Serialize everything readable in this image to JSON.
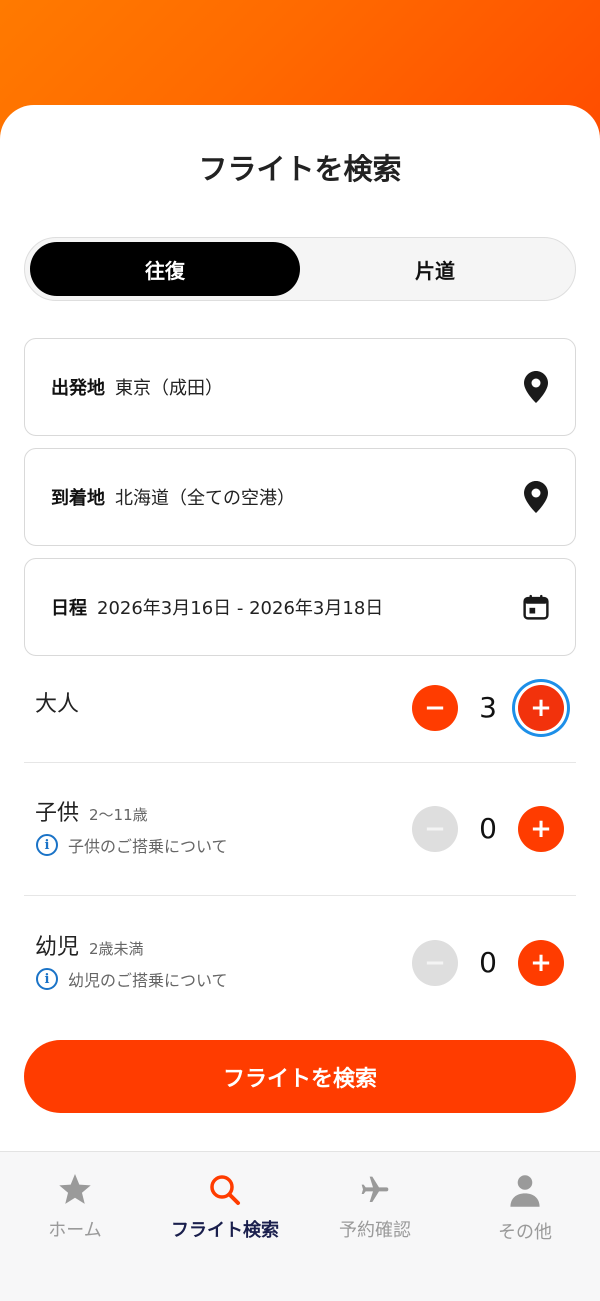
{
  "page": {
    "title": "フライトを検索"
  },
  "trip_type": {
    "round_trip": "往復",
    "one_way": "片道"
  },
  "fields": {
    "origin": {
      "label": "出発地",
      "value": "東京（成田）",
      "icon": "location-pin-icon"
    },
    "destination": {
      "label": "到着地",
      "value": "北海道（全ての空港）",
      "icon": "location-pin-icon"
    },
    "dates": {
      "label": "日程",
      "value": "2026年3月16日 - 2026年3月18日",
      "icon": "calendar-icon"
    }
  },
  "passengers": {
    "adult": {
      "label": "大人",
      "count": "3"
    },
    "child": {
      "label": "子供",
      "age": "2〜11歳",
      "count": "0",
      "info": "子供のご搭乗について"
    },
    "infant": {
      "label": "幼児",
      "age": "2歳未満",
      "count": "0",
      "info": "幼児のご搭乗について"
    }
  },
  "search_button": "フライトを検索",
  "tabs": [
    {
      "label": "ホーム",
      "icon": "star-icon"
    },
    {
      "label": "フライト検索",
      "icon": "search-icon"
    },
    {
      "label": "予約確認",
      "icon": "airplane-icon"
    },
    {
      "label": "その他",
      "icon": "person-icon"
    }
  ],
  "colors": {
    "accent": "#ff3c00",
    "focus_ring": "#1d8fe8",
    "info": "#1a73c7",
    "active_tab": "#1a1f4d"
  }
}
